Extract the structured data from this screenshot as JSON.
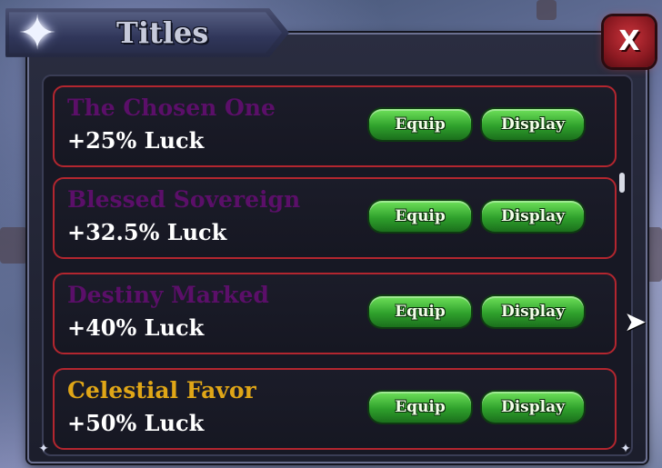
{
  "window": {
    "title": "Titles",
    "close_label": "X"
  },
  "colors": {
    "rare_name": "#5b0f69",
    "legendary_name": "#e0a617",
    "row_border": "#b3262f",
    "button_green": "#3cb334"
  },
  "icons": {
    "header": "sparkle-star-icon",
    "corner": "sparkle-star-icon"
  },
  "titles": [
    {
      "name": "The Chosen One",
      "bonus": "+25% Luck",
      "color": "#5b0f69",
      "equip_label": "Equip",
      "display_label": "Display"
    },
    {
      "name": "Blessed Sovereign",
      "bonus": "+32.5% Luck",
      "color": "#5b0f69",
      "equip_label": "Equip",
      "display_label": "Display"
    },
    {
      "name": "Destiny Marked",
      "bonus": "+40% Luck",
      "color": "#5b0f69",
      "equip_label": "Equip",
      "display_label": "Display"
    },
    {
      "name": "Celestial Favor",
      "bonus": "+50% Luck",
      "color": "#e0a617",
      "equip_label": "Equip",
      "display_label": "Display"
    }
  ]
}
